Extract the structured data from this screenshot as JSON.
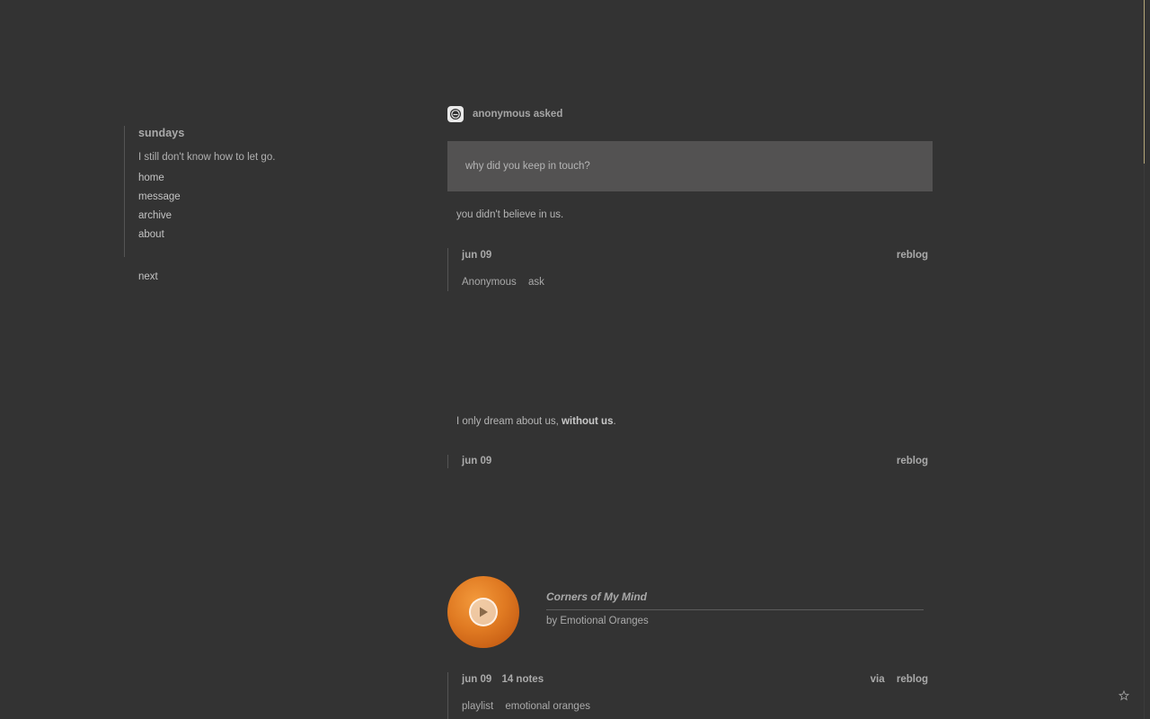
{
  "sidebar": {
    "title": "sundays",
    "description": "I still don't know how to let go.",
    "nav": [
      {
        "label": "home"
      },
      {
        "label": "message"
      },
      {
        "label": "archive"
      },
      {
        "label": "about"
      }
    ],
    "pager_next": "next"
  },
  "posts": {
    "ask": {
      "asker": "anonymous asked",
      "question": "why did you keep in touch?",
      "answer": "you didn't believe in us.",
      "date": "jun 09",
      "reblog": "reblog",
      "tags": [
        "Anonymous",
        "ask"
      ]
    },
    "text": {
      "body_prefix": "I only dream about us, ",
      "body_bold": "without us",
      "body_suffix": ".",
      "date": "jun 09",
      "reblog": "reblog"
    },
    "audio": {
      "track_title": "Corners of My Mind",
      "artist": "by Emotional Oranges",
      "date": "jun 09",
      "notes": "14 notes",
      "via": "via",
      "reblog": "reblog",
      "tags": [
        "playlist",
        "emotional oranges"
      ],
      "album_color": "#e07a22"
    }
  },
  "colors": {
    "background": "#333333",
    "question_box": "#535252",
    "scroll_thumb": "#b5a77a"
  },
  "icons": {
    "asker_avatar": "anonymous-avatar-icon",
    "play": "play-icon",
    "star": "star-icon"
  }
}
